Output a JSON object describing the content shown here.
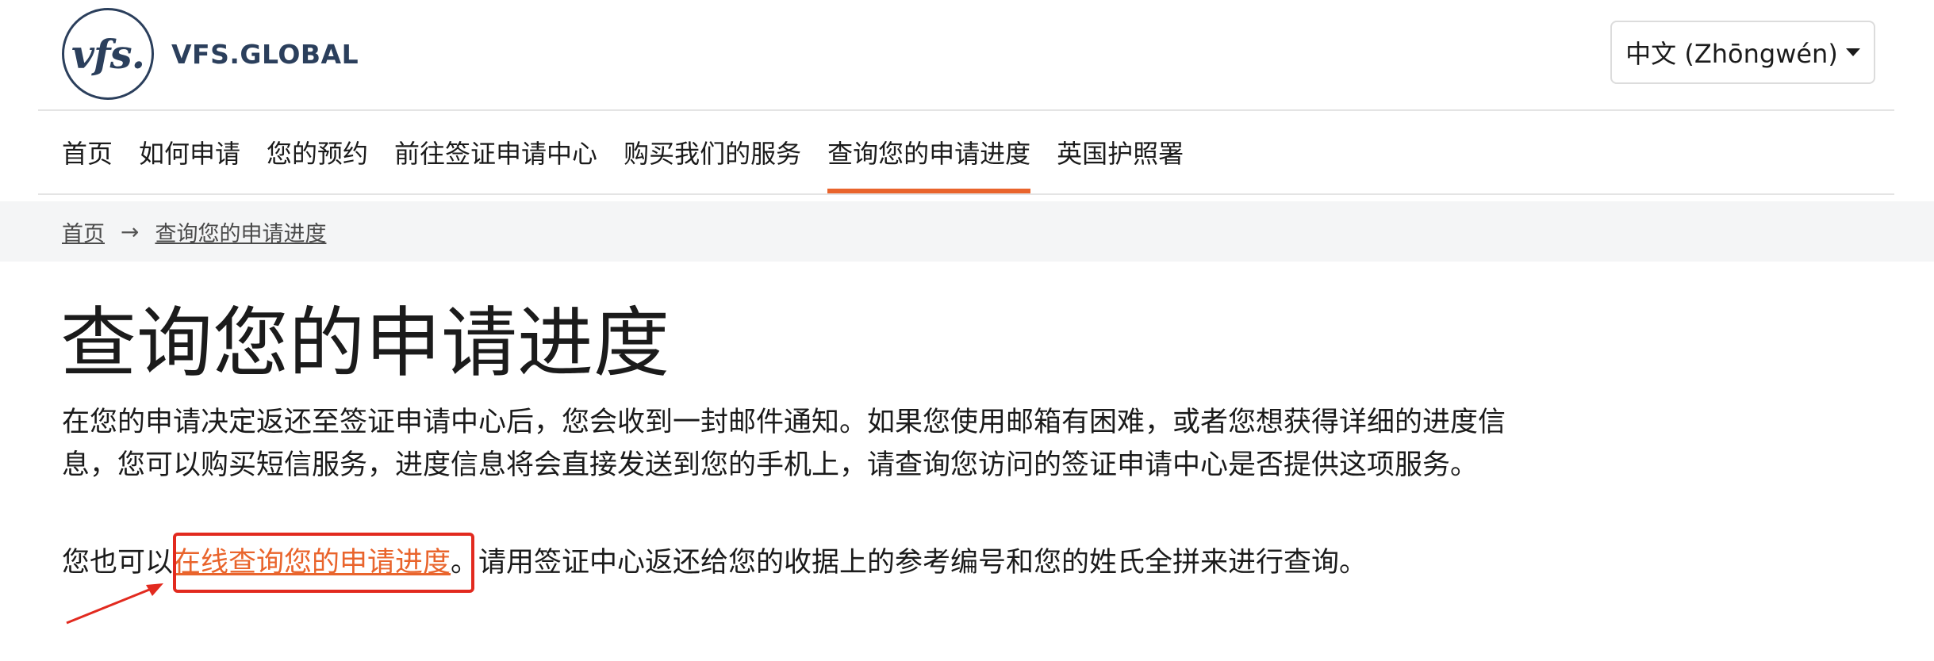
{
  "brand": {
    "logo_mark": "vfs.",
    "logo_text": "VFS.GLOBAL"
  },
  "language": {
    "selected": "中文 (Zhōngwén)"
  },
  "nav": {
    "items": [
      {
        "label": "首页"
      },
      {
        "label": "如何申请"
      },
      {
        "label": "您的预约"
      },
      {
        "label": "前往签证申请中心"
      },
      {
        "label": "购买我们的服务"
      },
      {
        "label": "查询您的申请进度",
        "active": true
      },
      {
        "label": "英国护照署"
      }
    ]
  },
  "breadcrumb": {
    "home": "首页",
    "separator": "→",
    "current": "查询您的申请进度"
  },
  "main": {
    "title": "查询您的申请进度",
    "paragraph1": "在您的申请决定返还至签证申请中心后，您会收到一封邮件通知。如果您使用邮箱有困难，或者您想获得详细的进度信息，您可以购买短信服务，进度信息将会直接发送到您的手机上，请查询您访问的签证申请中心是否提供这项服务。",
    "paragraph2_before": "您也可以",
    "paragraph2_link": "在线查询您的申请进度",
    "paragraph2_after": "。请用签证中心返还给您的收据上的参考编号和您的姓氏全拼来进行查询。"
  },
  "colors": {
    "accent": "#e9642c",
    "brand": "#2b3f5c",
    "annotation": "#e22a1f",
    "breadcrumb_bg": "#f4f5f6"
  }
}
